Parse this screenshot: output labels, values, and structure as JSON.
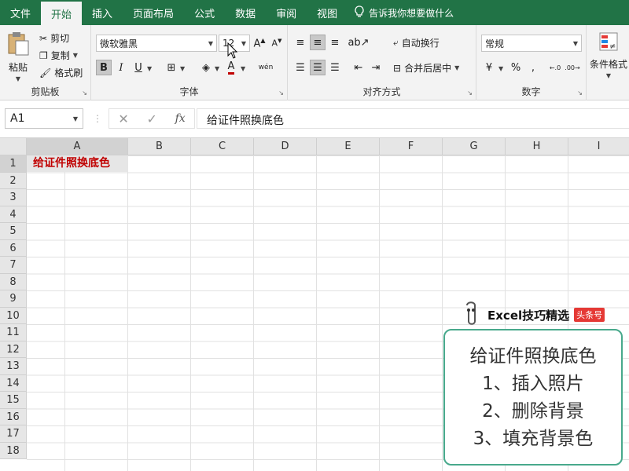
{
  "tabs": [
    "文件",
    "开始",
    "插入",
    "页面布局",
    "公式",
    "数据",
    "审阅",
    "视图"
  ],
  "active_tab_index": 1,
  "tellme": "告诉我你想要做什么",
  "clipboard": {
    "paste": "粘贴",
    "cut": "剪切",
    "copy": "复制",
    "format_painter": "格式刷",
    "label": "剪贴板"
  },
  "font": {
    "name": "微软雅黑",
    "size": "12",
    "label": "字体",
    "bold": "B",
    "italic": "I",
    "underline": "U",
    "phonetic": "wén"
  },
  "alignment": {
    "wrap": "自动换行",
    "merge": "合并后居中",
    "label": "对齐方式"
  },
  "number": {
    "format": "常规",
    "label": "数字"
  },
  "styles": {
    "conditional": "条件格式"
  },
  "namebox": "A1",
  "formula": "给证件照换底色",
  "columns": [
    "A",
    "B",
    "C",
    "D",
    "E",
    "F",
    "G",
    "H",
    "I"
  ],
  "rows": [
    "1",
    "2",
    "3",
    "4",
    "5",
    "6",
    "7",
    "8",
    "9",
    "10",
    "11",
    "12",
    "13",
    "14",
    "15",
    "16",
    "17",
    "18"
  ],
  "cell_a1": "给证件照换底色",
  "card": {
    "brand": "Excel技巧精选",
    "badge": "头条号",
    "lines": [
      "给证件照换底色",
      "1、插入照片",
      "2、删除背景",
      "3、填充背景色"
    ]
  },
  "colors": {
    "excel_green": "#217346",
    "cell_text_red": "#c00000",
    "card_border": "#48a98c"
  }
}
